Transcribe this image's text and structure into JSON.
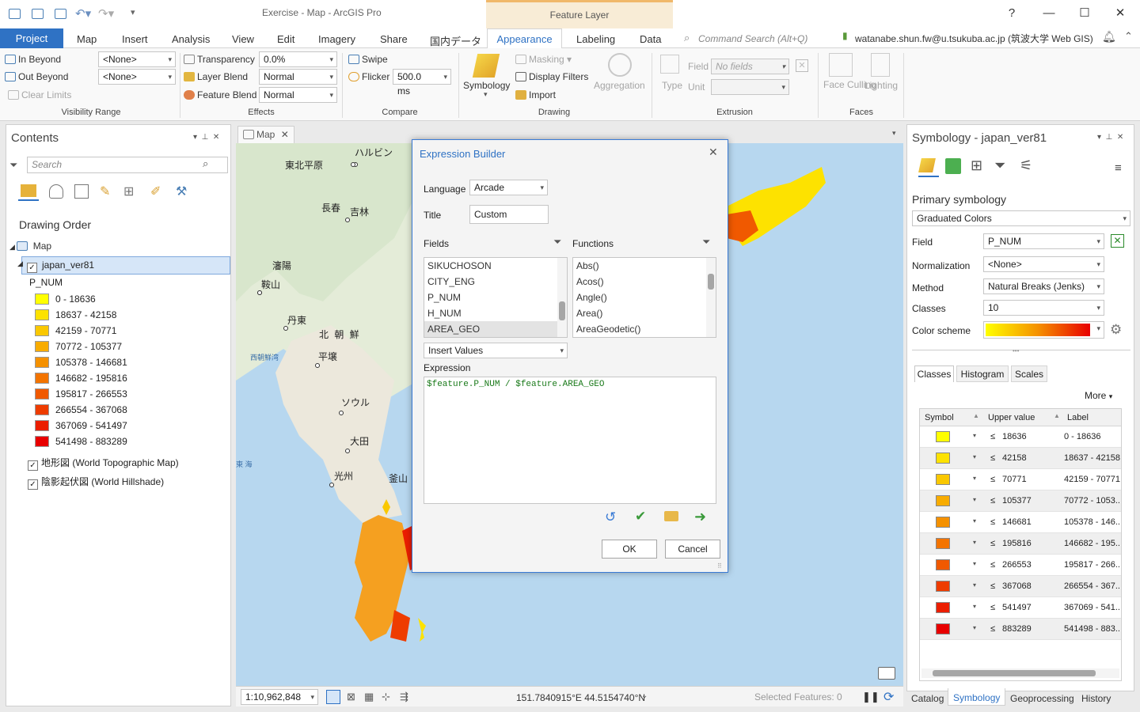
{
  "window": {
    "title": "Exercise - Map - ArcGIS Pro",
    "context_tab": "Feature Layer",
    "user": "watanabe.shun.fw@u.tsukuba.ac.jp (筑波大学 Web GIS)",
    "help": "?"
  },
  "menu_tabs": [
    "Project",
    "Map",
    "Insert",
    "Analysis",
    "View",
    "Edit",
    "Imagery",
    "Share",
    "国内データ",
    "Appearance",
    "Labeling",
    "Data"
  ],
  "command_search": "Command Search (Alt+Q)",
  "ribbon": {
    "visibility": {
      "in_beyond": "In Beyond",
      "out_beyond": "Out Beyond",
      "clear_limits": "Clear Limits",
      "in_value": "<None>",
      "out_value": "<None>",
      "group": "Visibility Range"
    },
    "effects": {
      "transparency": "Transparency",
      "transparency_value": "0.0%",
      "layer_blend": "Layer Blend",
      "layer_blend_value": "Normal",
      "feature_blend": "Feature Blend",
      "feature_blend_value": "Normal",
      "group": "Effects"
    },
    "compare": {
      "swipe": "Swipe",
      "flicker": "Flicker",
      "flicker_value": "500.0",
      "flicker_unit": "ms",
      "group": "Compare"
    },
    "drawing": {
      "symbology": "Symbology",
      "masking": "Masking",
      "display_filters": "Display Filters",
      "import": "Import",
      "aggregation": "Aggregation",
      "group": "Drawing"
    },
    "extrusion": {
      "type": "Type",
      "field": "Field",
      "field_value": "No fields",
      "unit": "Unit",
      "group": "Extrusion"
    },
    "faces": {
      "face_culling": "Face Culling",
      "lighting": "Lighting",
      "group": "Faces"
    }
  },
  "contents": {
    "title": "Contents",
    "search_placeholder": "Search",
    "drawing_order": "Drawing Order",
    "map_name": "Map",
    "layer_name": "japan_ver81",
    "field": "P_NUM",
    "classes": [
      {
        "label": "0 - 18636",
        "color": "#ffff00"
      },
      {
        "label": "18637 - 42158",
        "color": "#fde200"
      },
      {
        "label": "42159 - 70771",
        "color": "#fac800"
      },
      {
        "label": "70772 - 105377",
        "color": "#f8ac00"
      },
      {
        "label": "105378 - 146681",
        "color": "#f59100"
      },
      {
        "label": "146682 - 195816",
        "color": "#f37400"
      },
      {
        "label": "195817 - 266553",
        "color": "#f05900"
      },
      {
        "label": "266554 - 367068",
        "color": "#ee3c00"
      },
      {
        "label": "367069 - 541497",
        "color": "#eb1e00"
      },
      {
        "label": "541498 - 883289",
        "color": "#e80000"
      }
    ],
    "basemaps": [
      "地形図 (World Topographic Map)",
      "陰影起伏図 (World Hillshade)"
    ]
  },
  "map": {
    "tab": "Map",
    "labels": [
      "ハルビン",
      "東北平原",
      "長春",
      "吉林",
      "瀋陽",
      "鞍山",
      "丹東",
      "北 朝 鮮",
      "平壌",
      "西朝鮮湾",
      "ソウル",
      "大田",
      "光州",
      "釜山",
      "東 海"
    ],
    "scale": "1:10,962,848",
    "coords": "151.7840915°E 44.5154740°N",
    "selected": "Selected Features: 0"
  },
  "dialog": {
    "title": "Expression Builder",
    "language_label": "Language",
    "language": "Arcade",
    "title_label": "Title",
    "title_value": "Custom",
    "fields_label": "Fields",
    "functions_label": "Functions",
    "fields": [
      "SIKUCHOSON",
      "CITY_ENG",
      "P_NUM",
      "H_NUM",
      "AREA_GEO"
    ],
    "functions": [
      "Abs()",
      "Acos()",
      "Angle()",
      "Area()",
      "AreaGeodetic()"
    ],
    "insert_values": "Insert Values",
    "expression_label": "Expression",
    "expression": "$feature.P_NUM / $feature.AREA_GEO",
    "ok": "OK",
    "cancel": "Cancel"
  },
  "symbology": {
    "title": "Symbology - japan_ver81",
    "primary": "Primary symbology",
    "renderer": "Graduated Colors",
    "field_label": "Field",
    "field": "P_NUM",
    "normalization_label": "Normalization",
    "normalization": "<None>",
    "method_label": "Method",
    "method": "Natural Breaks (Jenks)",
    "classes_label": "Classes",
    "classes": "10",
    "color_scheme_label": "Color scheme",
    "subtabs": [
      "Classes",
      "Histogram",
      "Scales"
    ],
    "more": "More",
    "col_symbol": "Symbol",
    "col_upper": "Upper value",
    "col_label": "Label",
    "rows": [
      {
        "upper": "18636",
        "label": "0 - 18636",
        "color": "#ffff00"
      },
      {
        "upper": "42158",
        "label": "18637 - 42158",
        "color": "#fde200"
      },
      {
        "upper": "70771",
        "label": "42159 - 70771",
        "color": "#fac800"
      },
      {
        "upper": "105377",
        "label": "70772 - 1053...",
        "color": "#f8ac00"
      },
      {
        "upper": "146681",
        "label": "105378 - 146...",
        "color": "#f59100"
      },
      {
        "upper": "195816",
        "label": "146682 - 195...",
        "color": "#f37400"
      },
      {
        "upper": "266553",
        "label": "195817 - 266...",
        "color": "#f05900"
      },
      {
        "upper": "367068",
        "label": "266554 - 367...",
        "color": "#ee3c00"
      },
      {
        "upper": "541497",
        "label": "367069 - 541...",
        "color": "#eb1e00"
      },
      {
        "upper": "883289",
        "label": "541498 - 883...",
        "color": "#e80000"
      }
    ]
  },
  "bottom_tabs": [
    "Catalog",
    "Symbology",
    "Geoprocessing",
    "History"
  ]
}
